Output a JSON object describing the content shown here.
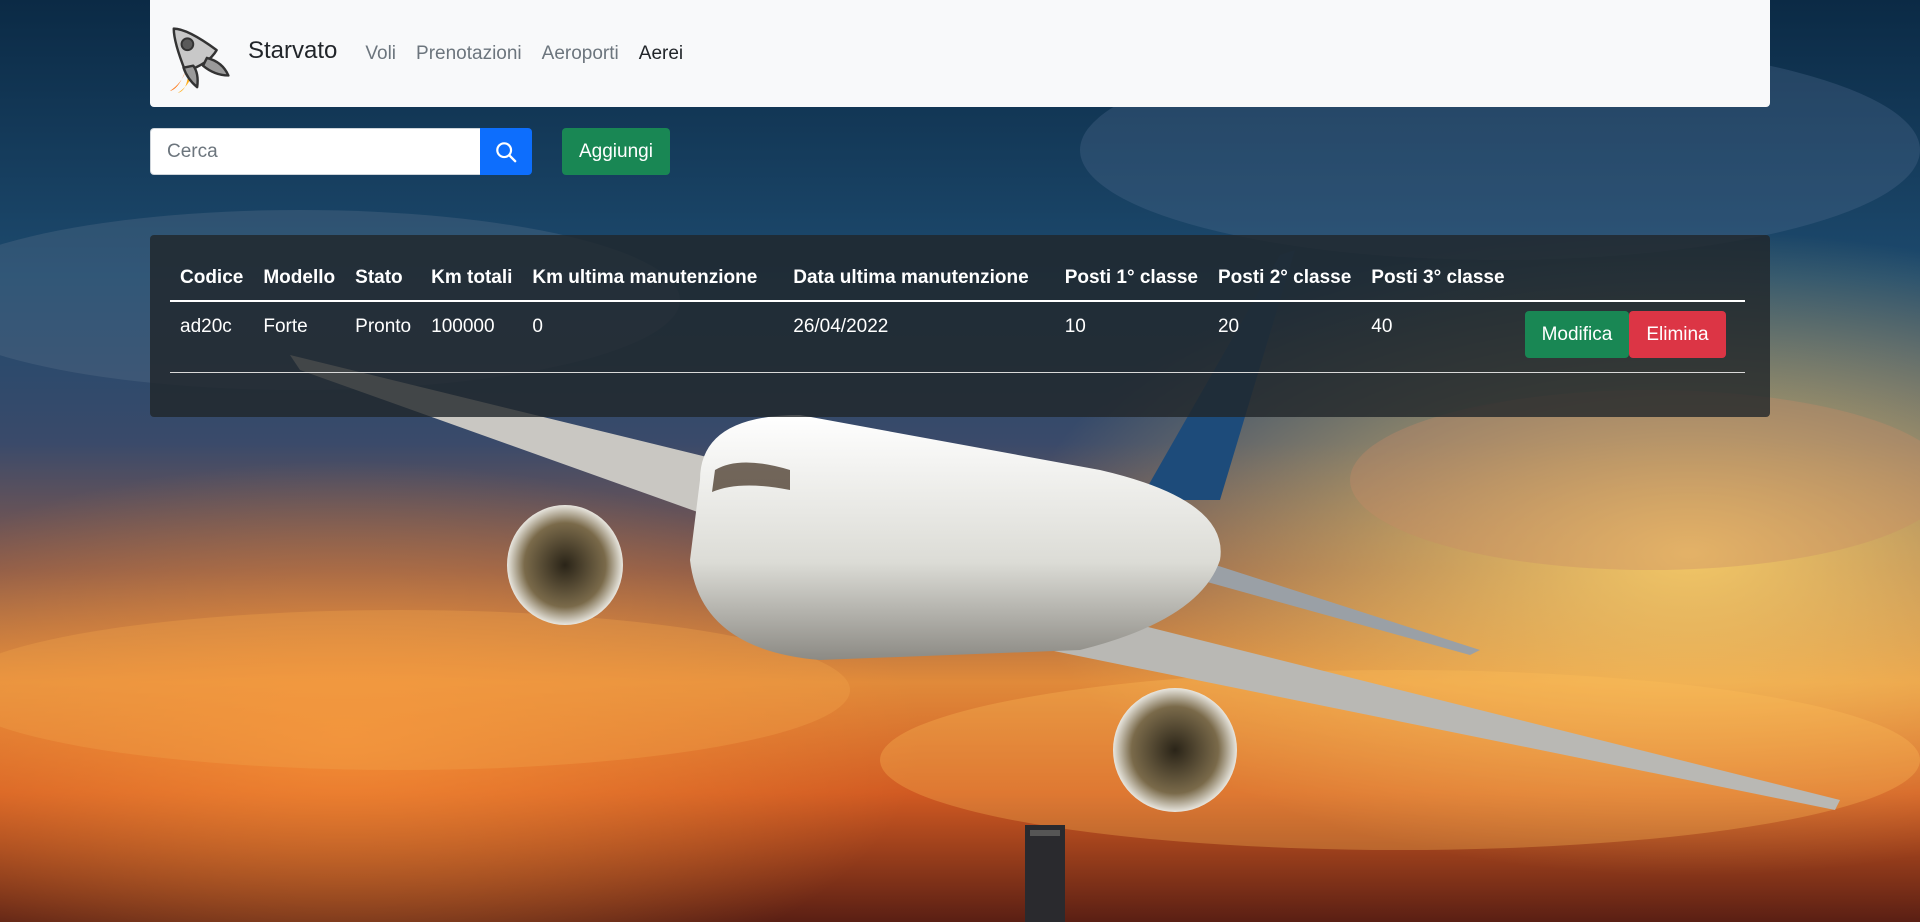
{
  "theme": {
    "primary": "#0d6efd",
    "success": "#198754",
    "danger": "#dc3545",
    "navbar_bg": "#f8f9fa",
    "panel_bg": "#212529"
  },
  "navbar": {
    "brand": "Starvato",
    "logo_icon": "rocket-icon",
    "links": [
      {
        "label": "Voli",
        "active": false
      },
      {
        "label": "Prenotazioni",
        "active": false
      },
      {
        "label": "Aeroporti",
        "active": false
      },
      {
        "label": "Aerei",
        "active": true
      }
    ]
  },
  "search": {
    "placeholder": "Cerca",
    "value": "",
    "button_icon": "search-icon"
  },
  "toolbar": {
    "add_label": "Aggiungi"
  },
  "table": {
    "headers": [
      "Codice",
      "Modello",
      "Stato",
      "Km totali",
      "Km ultima manutenzione",
      "Data ultima manutenzione",
      "Posti 1° classe",
      "Posti 2° classe",
      "Posti 3° classe"
    ],
    "rows": [
      {
        "cells": [
          "ad20c",
          "Forte",
          "Pronto",
          "100000",
          "0",
          "26/04/2022",
          "10",
          "20",
          "40"
        ],
        "edit_label": "Modifica",
        "delete_label": "Elimina"
      }
    ]
  }
}
